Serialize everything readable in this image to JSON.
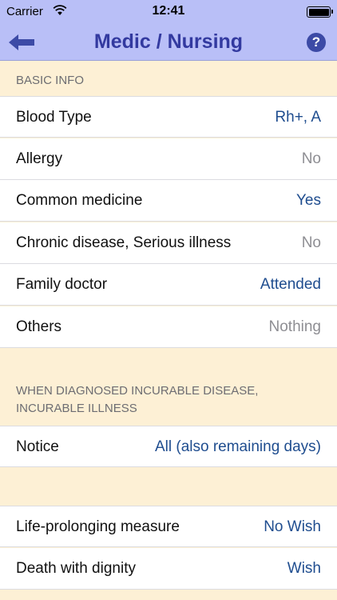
{
  "status_bar": {
    "carrier": "Carrier",
    "time": "12:41"
  },
  "nav": {
    "title": "Medic / Nursing",
    "help_glyph": "?"
  },
  "colors": {
    "nav_background": "#b9bff7",
    "title_color": "#333aa0",
    "section_background": "#fdf0d5",
    "value_active": "#1f4d8f",
    "value_muted": "#8e8e93"
  },
  "sections": [
    {
      "header": "BASIC INFO",
      "rows": [
        {
          "label": "Blood Type",
          "value": "Rh+, A",
          "state": "active"
        },
        {
          "label": "Allergy",
          "value": "No",
          "state": "muted"
        },
        {
          "label": "Common medicine",
          "value": "Yes",
          "state": "active"
        },
        {
          "label": "Chronic disease, Serious illness",
          "value": "No",
          "state": "muted"
        },
        {
          "label": "Family doctor",
          "value": "Attended",
          "state": "active"
        },
        {
          "label": "Others",
          "value": "Nothing",
          "state": "muted"
        }
      ]
    },
    {
      "header_line1": "WHEN DIAGNOSED INCURABLE DISEASE,",
      "header_line2": "INCURABLE ILLNESS",
      "rows": [
        {
          "label": "Notice",
          "value": "All (also remaining days)",
          "state": "active"
        }
      ]
    },
    {
      "rows": [
        {
          "label": "Life-prolonging measure",
          "value": "No Wish",
          "state": "active"
        },
        {
          "label": "Death with dignity",
          "value": "Wish",
          "state": "active"
        }
      ]
    }
  ]
}
